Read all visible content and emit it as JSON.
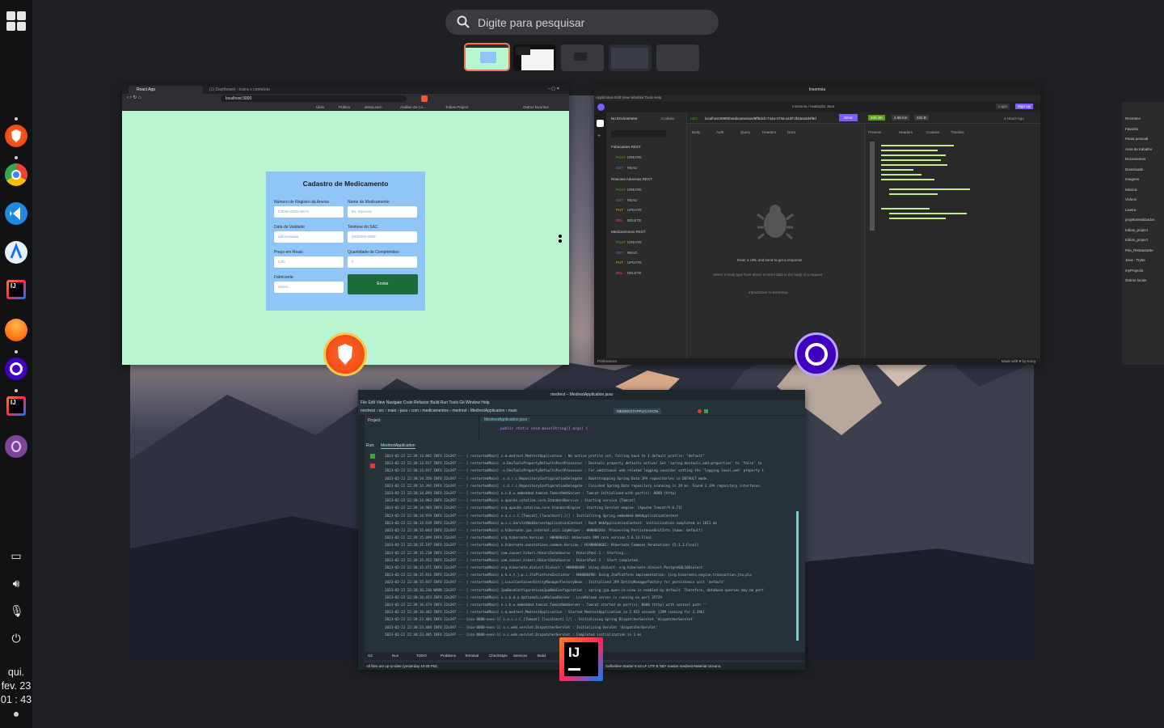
{
  "search": {
    "placeholder": "Digite para pesquisar"
  },
  "clock": {
    "day": "qui.",
    "date": "fev. 23",
    "time": "01 : 43"
  },
  "dock": {
    "apps": [
      "brave-icon",
      "chrome-icon",
      "vscode-icon",
      "android-studio-icon",
      "intellij-icon",
      "firefox-icon",
      "insomnia-icon",
      "intellij-icon",
      "tor-browser-icon"
    ]
  },
  "browser": {
    "tab_active": "React App",
    "tab_other": "(1) Dashboard - Insira o conteúdo",
    "url": "localhost:3000",
    "bookmarks": [
      "Úteis",
      "Prática",
      "deepLearn",
      "Análise da Co...",
      "Tobias Project",
      "Outros favoritos"
    ],
    "form": {
      "title": "Cadastro de Medicamento",
      "anvisa_label": "Número de Registro da Anvisa",
      "anvisa_placeholder": "0.0000.0000.000-0",
      "name_label": "Nome do Medicamento",
      "name_placeholder": "Ex. Dipirona",
      "validity_label": "Data de Validade",
      "validity_placeholder": "dd/mm/aaaa",
      "phone_label": "Telefone do SAC",
      "phone_placeholder": "(00)0000-0000",
      "price_label": "Preço em Reais",
      "price_placeholder": "0,00",
      "qty_label": "Quantidade de Comprimidos",
      "qty_placeholder": "0",
      "maker_label": "Fabricante",
      "maker_placeholder": "Select...",
      "submit": "Enviar"
    }
  },
  "insomnia": {
    "title": "Insomnia",
    "menu": "Application  Edit  View  Window  Tools  Help",
    "breadcrumb": "Insomnia / Avaliação Java",
    "login": "Login",
    "signup": "Sign Up",
    "env": "No Environment",
    "cookies": "Cookies",
    "method": "GET",
    "url": "localhost:8080/medicamentos/9ff9dcb-744a-473a-a19f-3f43ea3d4f9d",
    "send": "Send",
    "status": "200 OK",
    "time": "4.58 ms",
    "size": "333 B",
    "ago": "3 Hours Ago",
    "req_tabs": [
      "Body",
      "Auth",
      "Query",
      "Headers",
      "Docs"
    ],
    "res_tabs": [
      "Preview",
      "Headers",
      "Cookies",
      "Timeline"
    ],
    "folders": [
      {
        "name": "Fabricantes REST",
        "items": [
          [
            "POST",
            "CREATE"
          ],
          [
            "GET",
            "READ"
          ]
        ]
      },
      {
        "name": "Reacoes Adversas REST",
        "items": [
          [
            "POST",
            "CREATE"
          ],
          [
            "GET",
            "READ"
          ],
          [
            "PUT",
            "UPDATE"
          ],
          [
            "DEL",
            "DELETE"
          ]
        ]
      },
      {
        "name": "Medicamentos REST",
        "items": [
          [
            "POST",
            "CREATE"
          ],
          [
            "GET",
            "READ"
          ],
          [
            "PUT",
            "UPDATE"
          ],
          [
            "DEL",
            "DELETE"
          ]
        ]
      }
    ],
    "empty_title": "Enter a URL and send to get a response",
    "empty_sub": "Select a body type from above to send data in the body of a request",
    "intro": "Introduction to Insomnia",
    "prefs": "Preferences",
    "footer_right": "Made with ♥ by Kong"
  },
  "intellij": {
    "title": "medrest – MedrestApplication.java",
    "menu": "File  Edit  View  Navigate  Code  Refactor  Build  Run  Tools  Git  Window  Help",
    "breadcrumb": "medrest › src › main › java › com › medicamentos › medrest › MedrestApplication › main",
    "run_config": "MEDRESTAPPLICATION",
    "project_tab": "Project",
    "file_tab": "MedrestApplication.java",
    "run_label": "Run:",
    "run_app": "MedrestApplication",
    "code": "public static void main(String[] args) {",
    "log_lines": [
      "2023-02-22 22:38:13.882  INFO 22o397 --- [  restartedMain] c.m.medrest.MedrestApplication        : No active profile set, falling back to 1 default profile: \"default\"",
      "2023-02-22 22:38:13.937  INFO 22o397 --- [  restartedMain] .e.DevToolsPropertyDefaultsPostProcessor : Devtools property defaults active! Set 'spring.devtools.add-properties' to 'false' to",
      "2023-02-22 22:38:13.937  INFO 22o397 --- [  restartedMain] .e.DevToolsPropertyDefaultsPostProcessor : For additional web related logging consider setting the 'logging.level.web' property t",
      "2023-02-22 22:38:14.356  INFO 22o397 --- [  restartedMain] .s.d.r.c.RepositoryConfigurationDelegate : Bootstrapping Spring Data JPA repositories in DEFAULT mode.",
      "2023-02-22 22:38:14.392  INFO 22o397 --- [  restartedMain] .s.d.r.c.RepositoryConfigurationDelegate : Finished Spring Data repository scanning in 29 ms. Found 3 JPA repository interfaces.",
      "2023-02-22 22:38:14.894  INFO 22o397 --- [  restartedMain] o.s.b.w.embedded.tomcat.TomcatWebServer : Tomcat initialized with port(s): 8080 (http)",
      "2023-02-22 22:38:14.903  INFO 22o397 --- [  restartedMain] o.apache.catalina.core.StandardService : Starting service [Tomcat]",
      "2023-02-22 22:38:14.903  INFO 22o397 --- [  restartedMain] org.apache.catalina.core.StandardEngine : Starting Servlet engine: [Apache Tomcat/9.0.71]",
      "2023-02-22 22:38:14.939  INFO 22o397 --- [  restartedMain] o.a.c.c.C.[Tomcat].[localhost].[/]    : Initializing Spring embedded WebApplicationContext",
      "2023-02-22 22:38:14.939  INFO 22o397 --- [  restartedMain] w.s.c.ServletWebServerApplicationContext : Root WebApplicationContext: initialization completed in 1011 ms",
      "2023-02-22 22:38:15.044  INFO 22o397 --- [  restartedMain] o.hibernate.jpa.internal.util.LogHelper : HHH000204: Processing PersistenceUnitInfo [name: default]",
      "2023-02-22 22:38:15.099  INFO 22o397 --- [  restartedMain] org.hibernate.Version                 : HHH000412: Hibernate ORM core version 5.6.14.Final",
      "2023-02-22 22:38:15.197  INFO 22o397 --- [  restartedMain] o.hibernate.annotations.common.Version : HCANN000001: Hibernate Commons Annotations {5.1.2.Final}",
      "2023-02-22 22:38:15.238  INFO 22o397 --- [  restartedMain] com.zaxxer.hikari.HikariDataSource    : HikariPool-1 - Starting...",
      "2023-02-22 22:38:15.452  INFO 22o397 --- [  restartedMain] com.zaxxer.hikari.HikariDataSource    : HikariPool-1 - Start completed.",
      "2023-02-22 22:38:15.471  INFO 22o397 --- [  restartedMain] org.hibernate.dialect.Dialect         : HHH000400: Using dialect: org.hibernate.dialect.PostgreSQL10Dialect",
      "2023-02-22 22:38:15.931  INFO 22o397 --- [  restartedMain] o.h.e.t.j.p.i.JtaPlatformInitiator    : HHH000490: Using JtaPlatform implementation: [org.hibernate.engine.transaction.jta.pla",
      "2023-02-22 22:38:15.937  INFO 22o397 --- [  restartedMain] j.LocalContainerEntityManagerFactoryBean : Initialized JPA EntityManagerFactory for persistence unit 'default'",
      "2023-02-22 22:38:16.336  WARN 22o397 --- [  restartedMain] JpaBaseConfiguration$JpaWebConfiguration : spring.jpa.open-in-view is enabled by default. Therefore, database queries may be perf",
      "2023-02-22 22:38:16.453  INFO 22o397 --- [  restartedMain] o.s.b.d.a.OptionalLiveReloadServer    : LiveReload server is running on port 35729",
      "2023-02-22 22:38:16.474  INFO 22o397 --- [  restartedMain] o.s.b.w.embedded.tomcat.TomcatWebServer : Tomcat started on port(s): 8080 (http) with context path ''",
      "2023-02-22 22:38:16.482  INFO 22o397 --- [  restartedMain] c.m.medrest.MedrestApplication        : Started MedrestApplication in 2.933 seconds (JVM running for 3.296)",
      "2023-02-22 22:38:23.484  INFO 22o397 --- [nio-8080-exec-1] o.a.c.c.C.[Tomcat].[localhost].[/]    : Initializing Spring DispatcherServlet 'dispatcherServlet'",
      "2023-02-22 22:38:23.484  INFO 22o397 --- [nio-8080-exec-1] o.s.web.servlet.DispatcherServlet     : Initializing Servlet 'dispatcherServlet'",
      "2023-02-22 22:38:23.485  INFO 22o397 --- [nio-8080-exec-1] o.s.web.servlet.DispatcherServlet     : Completed initialization in 1 ms"
    ],
    "bottom_tabs": [
      "Git",
      "Run",
      "TODO",
      "Problems",
      "Terminal",
      "CheckStyle",
      "Services",
      "Build"
    ],
    "status": "All files are up-to-date (yesterday 10:28 PM)",
    "status_right": "Softonline Starter   9:43  LF  UTF-8  Tab*  master  medrest  Material Oceanic"
  },
  "files": {
    "items": [
      "Recentes",
      "Favorito",
      "Pasta pessoal",
      "Área de trabalho",
      "Documentos",
      "Downloads",
      "Imagens",
      "Música",
      "Vídeos",
      "Lixeira",
      "projetosrealizados",
      "tobias_project",
      "tobias_project",
      "Pdv_Restaurante",
      "Java - Trybe",
      "myProjects",
      "Outros locais"
    ]
  },
  "colors": {
    "accent": "#f0774a",
    "form_bg": "#90c5f7",
    "page_bg": "#b9f5d0",
    "submit": "#1d6b3a",
    "send": "#7a5cff"
  }
}
